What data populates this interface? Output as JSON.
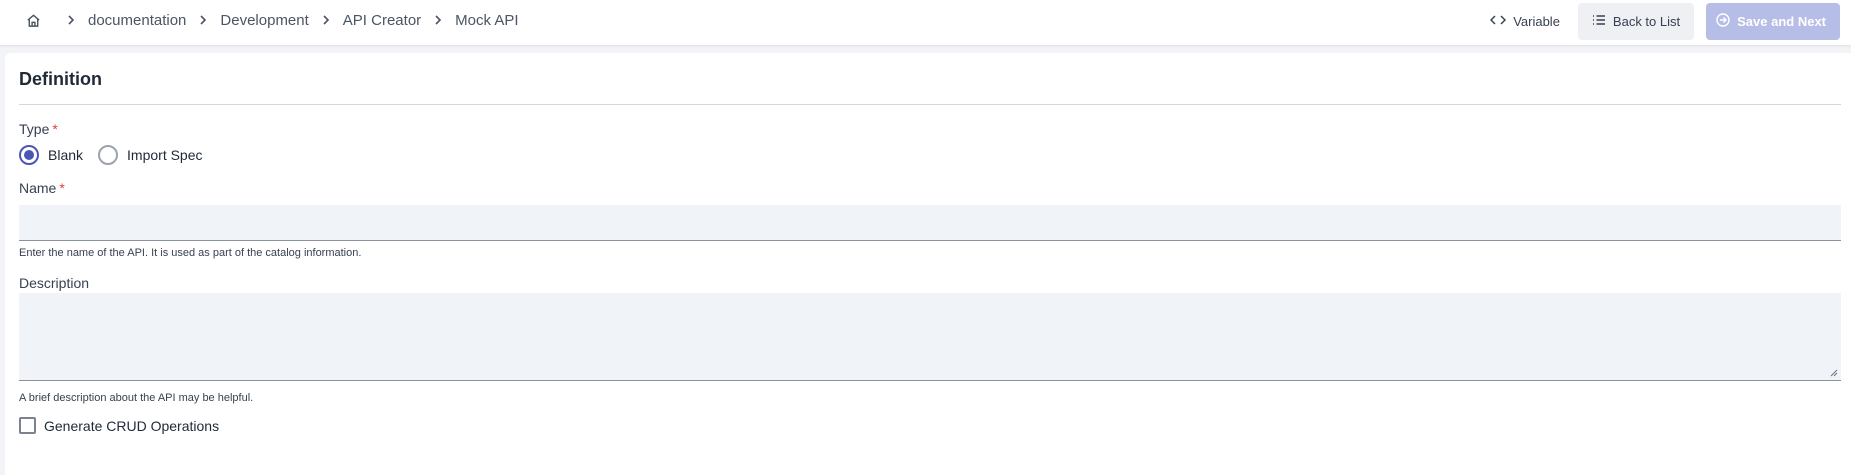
{
  "breadcrumb": {
    "items": [
      "documentation",
      "Development",
      "API Creator",
      "Mock API"
    ]
  },
  "toolbar": {
    "variable_label": "Variable",
    "back_label": "Back to List",
    "save_label": "Save and Next"
  },
  "form": {
    "section_title": "Definition",
    "type_label": "Type",
    "required_mark": "*",
    "type_options": [
      "Blank",
      "Import Spec"
    ],
    "type_selected": "Blank",
    "name_label": "Name",
    "name_value": "",
    "name_help": "Enter the name of the API. It is used as part of the catalog information.",
    "description_label": "Description",
    "description_value": "",
    "description_help": "A brief description about the API may be helpful.",
    "crud_label": "Generate CRUD Operations",
    "crud_checked": false
  },
  "colors": {
    "accent": "#4c57b5",
    "save_disabled": "#b6bde6",
    "required": "#e23b3b",
    "input_bg": "#f0f3f7"
  },
  "icons": [
    "home-icon",
    "chevron-right-icon",
    "code-icon",
    "list-icon",
    "arrow-circle-right-icon"
  ]
}
